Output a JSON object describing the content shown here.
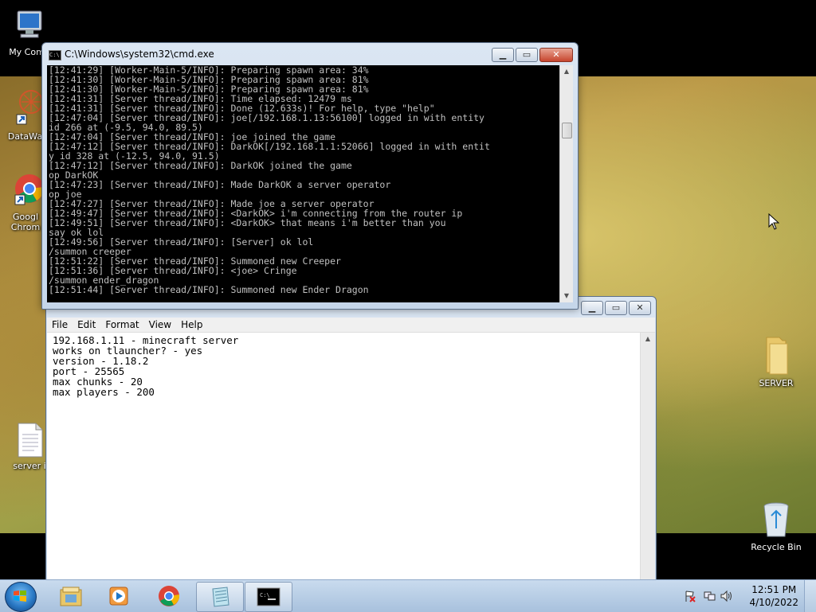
{
  "desktop": {
    "icons": [
      {
        "label": "My Comp",
        "icon": "computer-icon"
      },
      {
        "label": "DataWag",
        "icon": "datawag-shortcut-icon"
      },
      {
        "label": "Googl Chrom",
        "icon": "chrome-shortcut-icon"
      },
      {
        "label": "server i",
        "icon": "text-file-icon"
      },
      {
        "label": "SERVER",
        "icon": "folder-icon"
      },
      {
        "label": "Recycle Bin",
        "icon": "recycle-bin-icon"
      }
    ]
  },
  "cmd_window": {
    "title": "C:\\Windows\\system32\\cmd.exe",
    "lines": [
      "[12:41:29] [Worker-Main-5/INFO]: Preparing spawn area: 34%",
      "[12:41:30] [Worker-Main-5/INFO]: Preparing spawn area: 81%",
      "[12:41:30] [Worker-Main-5/INFO]: Preparing spawn area: 81%",
      "[12:41:31] [Server thread/INFO]: Time elapsed: 12479 ms",
      "[12:41:31] [Server thread/INFO]: Done (12.633s)! For help, type \"help\"",
      "[12:47:04] [Server thread/INFO]: joe[/192.168.1.13:56100] logged in with entity",
      "id 266 at (-9.5, 94.0, 89.5)",
      "[12:47:04] [Server thread/INFO]: joe joined the game",
      "[12:47:12] [Server thread/INFO]: DarkOK[/192.168.1.1:52066] logged in with entit",
      "y id 328 at (-12.5, 94.0, 91.5)",
      "[12:47:12] [Server thread/INFO]: DarkOK joined the game",
      "op DarkOK",
      "[12:47:23] [Server thread/INFO]: Made DarkOK a server operator",
      "op joe",
      "[12:47:27] [Server thread/INFO]: Made joe a server operator",
      "[12:49:47] [Server thread/INFO]: <DarkOK> i'm connecting from the router ip",
      "[12:49:51] [Server thread/INFO]: <DarkOK> that means i'm better than you",
      "say ok lol",
      "[12:49:56] [Server thread/INFO]: [Server] ok lol",
      "/summon creeper",
      "[12:51:22] [Server thread/INFO]: Summoned new Creeper",
      "[12:51:36] [Server thread/INFO]: <joe> Cringe",
      "/summon ender_dragon",
      "[12:51:44] [Server thread/INFO]: Summoned new Ender Dragon"
    ]
  },
  "notepad": {
    "menu": [
      "File",
      "Edit",
      "Format",
      "View",
      "Help"
    ],
    "lines": [
      "192.168.1.11 - minecraft server",
      "works on tlauncher? - yes",
      "version - 1.18.2",
      "port - 25565",
      "max chunks - 20",
      "max players - 200"
    ]
  },
  "taskbar": {
    "apps": [
      {
        "name": "windows-explorer",
        "icon": "explorer-icon"
      },
      {
        "name": "media-player",
        "icon": "media-player-icon"
      },
      {
        "name": "chrome",
        "icon": "chrome-icon"
      },
      {
        "name": "notepad",
        "icon": "notepad-icon"
      },
      {
        "name": "cmd",
        "icon": "cmd-icon"
      }
    ],
    "clock_time": "12:51 PM",
    "clock_date": "4/10/2022"
  },
  "colors": {
    "console_bg": "#000000",
    "console_fg": "#c0c0c0",
    "close_button": "#c7452e"
  }
}
